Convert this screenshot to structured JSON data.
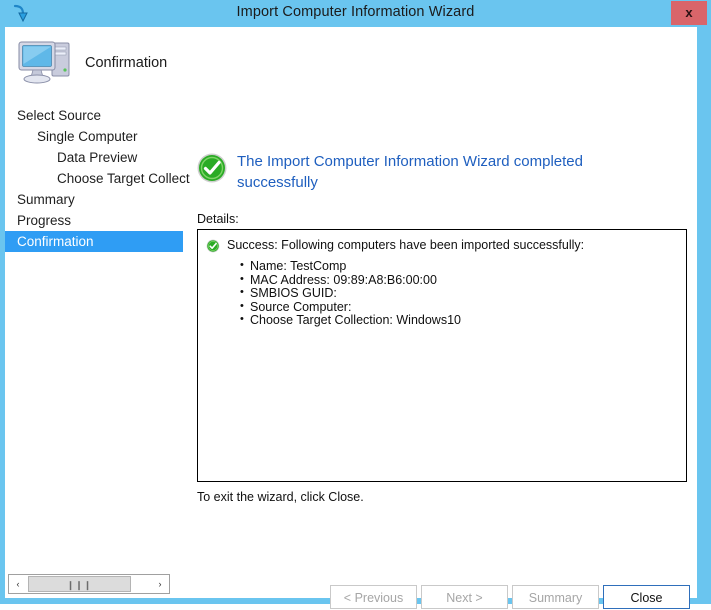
{
  "window": {
    "title": "Import Computer Information Wizard",
    "title_icon": "import-arrow-icon",
    "close_label": "x",
    "frame_color": "#6ac5ef"
  },
  "header": {
    "icon": "computer-icon",
    "title": "Confirmation"
  },
  "nav": {
    "items": [
      {
        "label": "Select Source",
        "level": 1,
        "selected": false
      },
      {
        "label": "Single Computer",
        "level": 2,
        "selected": false
      },
      {
        "label": "Data Preview",
        "level": 3,
        "selected": false
      },
      {
        "label": "Choose Target Collect",
        "level": 3,
        "selected": false
      },
      {
        "label": "Summary",
        "level": 1,
        "selected": false
      },
      {
        "label": "Progress",
        "level": 1,
        "selected": false
      },
      {
        "label": "Confirmation",
        "level": 1,
        "selected": true
      }
    ],
    "selected_color": "#2f9df4"
  },
  "content": {
    "result_icon": "green-check-circle-icon",
    "result_title": "The Import Computer Information Wizard completed successfully",
    "result_title_color": "#1f5fbf",
    "details_label": "Details:",
    "success_icon": "green-check-circle-icon",
    "success_text": "Success: Following computers have been imported successfully:",
    "detail_items": [
      "Name: TestComp",
      "MAC Address: 09:89:A8:B6:00:00",
      "SMBIOS GUID:",
      "Source Computer:",
      "Choose Target Collection: Windows10"
    ],
    "exit_text": "To exit the wizard, click Close."
  },
  "buttons": {
    "previous": "< Previous",
    "next": "Next >",
    "summary": "Summary",
    "close": "Close"
  },
  "scrollbar": {
    "left_arrow": "‹",
    "right_arrow": "›",
    "grip": "❙❙❙"
  }
}
